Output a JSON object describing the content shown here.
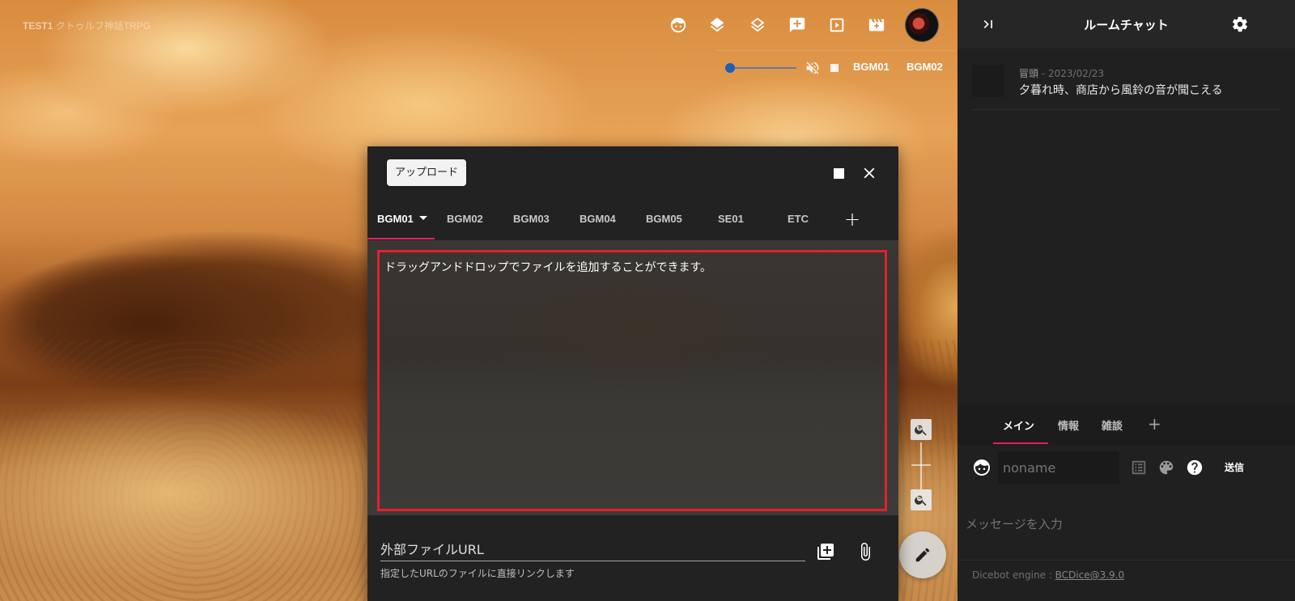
{
  "room": {
    "id": "TEST1",
    "name": "クトゥルフ神話TRPG"
  },
  "toolbar": {
    "icons": [
      "face-icon",
      "layers-filled-icon",
      "layers-outline-icon",
      "add-comment-icon",
      "slideshow-icon",
      "movie-icon"
    ]
  },
  "bgm_bar": {
    "volume_percent": 0,
    "channels": [
      "BGM01",
      "BGM02"
    ]
  },
  "dialog": {
    "upload_label": "アップロード",
    "tabs": [
      {
        "label": "BGM01",
        "active": true
      },
      {
        "label": "BGM02"
      },
      {
        "label": "BGM03"
      },
      {
        "label": "BGM04"
      },
      {
        "label": "BGM05"
      },
      {
        "label": "SE01"
      },
      {
        "label": "ETC"
      }
    ],
    "add_tab_label": "+",
    "drop_hint": "ドラッグアンドドロップでファイルを追加することができます。",
    "url_placeholder": "外部ファイルURL",
    "url_help": "指定したURLのファイルに直接リンクします"
  },
  "chat": {
    "title": "ルームチャット",
    "messages": [
      {
        "name": "冒頭",
        "date": "2023/02/23",
        "text": "夕暮れ時、商店から風鈴の音が聞こえる"
      }
    ],
    "tabs": [
      {
        "label": "メイン",
        "active": true
      },
      {
        "label": "情報"
      },
      {
        "label": "雑談"
      }
    ],
    "add_tab_label": "+",
    "name_placeholder": "noname",
    "send_label": "送信",
    "message_placeholder": "メッセージを入力",
    "dicebot_prefix": "Dicebot engine : ",
    "dicebot_version": "BCDice@3.9.0"
  },
  "colors": {
    "accent": "#e91e63",
    "highlight_border": "#e3202a",
    "panel": "#202020",
    "dialog": "#222222"
  }
}
